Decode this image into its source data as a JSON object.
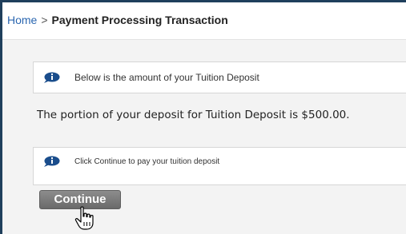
{
  "breadcrumb": {
    "home": "Home",
    "separator": ">",
    "current": "Payment Processing Transaction"
  },
  "info_messages": [
    {
      "icon": "speech-bubble-info-icon",
      "text": "Below is the amount of your Tuition Deposit"
    },
    {
      "icon": "speech-bubble-info-icon",
      "text": "Click Continue to pay your tuition deposit"
    }
  ],
  "deposit": {
    "text": "The portion of your deposit for Tuition Deposit is $500.00."
  },
  "actions": {
    "continue_label": "Continue"
  },
  "colors": {
    "frame_border": "#1f3f5c",
    "link": "#2a66b0",
    "button": "#7a7a7a",
    "icon": "#1a4d8c"
  }
}
